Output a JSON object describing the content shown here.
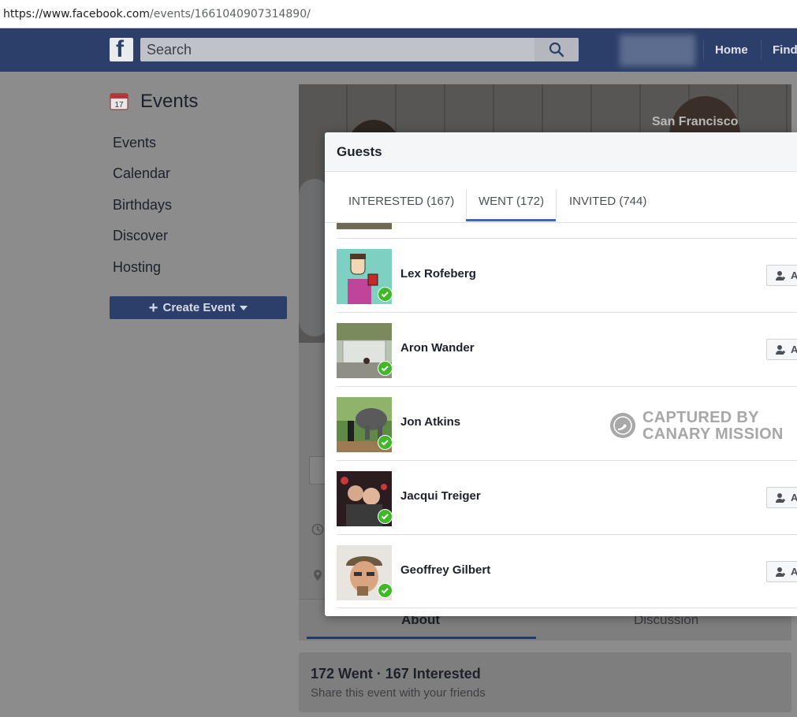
{
  "browser": {
    "url_host": "https://www.facebook.com",
    "url_path": "/events/1661040907314890/"
  },
  "topbar": {
    "logo": "f",
    "search_placeholder": "Search",
    "nav": [
      "Home",
      "Find"
    ]
  },
  "sidebar": {
    "title": "Events",
    "calendar_day": "17",
    "items": [
      "Events",
      "Calendar",
      "Birthdays",
      "Discover",
      "Hosting"
    ],
    "create_button": "Create Event"
  },
  "cover": {
    "caption": "San Francisco"
  },
  "event_tabs": {
    "about": "About",
    "discussion": "Discussion"
  },
  "summary": {
    "title": "172 Went · 167 Interested",
    "subtitle": "Share this event with your friends"
  },
  "modal": {
    "title": "Guests",
    "tabs": [
      {
        "label": "INTERESTED (167)"
      },
      {
        "label": "WENT (172)",
        "active": true
      },
      {
        "label": "INVITED (744)"
      }
    ],
    "guests": [
      {
        "name": "Lex Rofeberg",
        "add_label": "A"
      },
      {
        "name": "Aron Wander",
        "add_label": "A"
      },
      {
        "name": "Jon Atkins",
        "add_label": ""
      },
      {
        "name": "Jacqui Treiger",
        "add_label": "A"
      },
      {
        "name": "Geoffrey Gilbert",
        "add_label": "A"
      }
    ]
  },
  "watermark": {
    "line1": "CAPTURED BY",
    "line2": "CANARY MISSION"
  }
}
